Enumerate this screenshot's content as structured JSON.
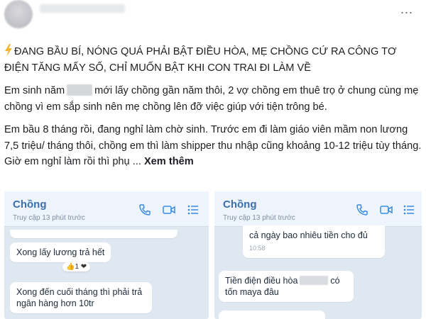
{
  "post": {
    "more_label": "...",
    "title": "ĐANG BẦU BÍ, NÓNG QUÁ PHẢI BẬT ĐIỀU HÒA, MẸ CHỒNG CỨ RA CÔNG TƠ ĐIỆN TĂNG MẤY SỐ, CHỈ MUỐN BẬT KHI CON TRAI ĐI LÀM VỀ",
    "para1_a": "Em sinh năm",
    "para1_b": "mới lấy chồng gần năm thôi, 2 vợ chồng em thuê trọ ở chung cùng mẹ chồng vì em sắp sinh nên mẹ chồng lên đỡ việc giúp với tiện trông bé.",
    "para2": "Em bầu 8 tháng rồi, đang nghỉ làm chờ sinh. Trước em đi làm giáo viên mầm non lương 7,5 triệu/ tháng thôi, chồng em thì làm shipper thu nhập cũng khoảng 10-12 triệu tùy tháng. Giờ em nghỉ làm rồi thì phụ ...",
    "see_more": "Xem thêm"
  },
  "chat_left": {
    "contact": "Chồng",
    "last_seen": "Truy cập 13 phút trước",
    "msg1": "Xong lấy lương trả hết",
    "react1": "👍1 ❤",
    "msg2": "Xong đến cuối tháng thì phải trả ngân hàng hơn 10tr"
  },
  "chat_right": {
    "contact": "Chồng",
    "last_seen": "Truy cập 13 phút trước",
    "msg1": "cả ngày bao nhiêu tiền cho đủ",
    "msg1_time": "10:58",
    "msg2_a": "Tiền điện điều hòa",
    "msg2_b": "có tốn maya đâu"
  },
  "icons": {
    "header": [
      "phone-icon",
      "video-icon",
      "list-icon"
    ],
    "accent": "#3a8be0"
  }
}
